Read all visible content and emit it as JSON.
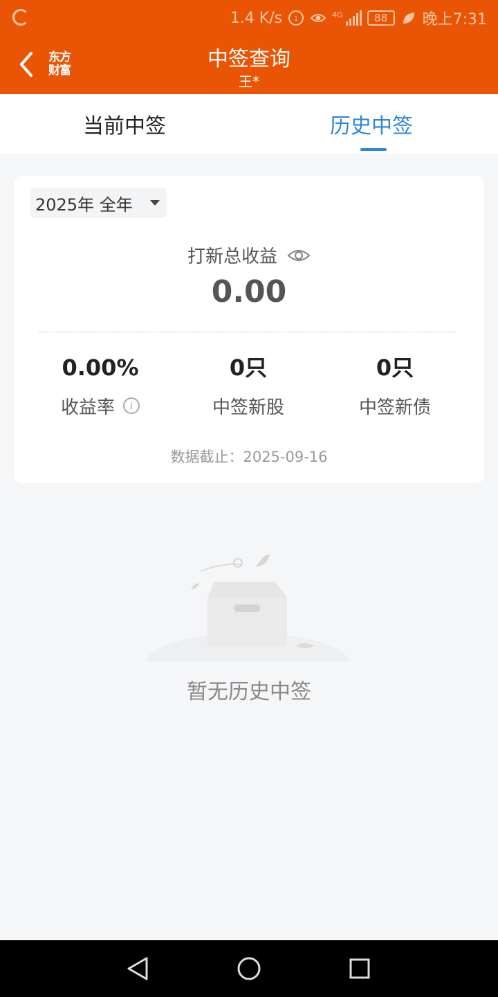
{
  "status_bar": {
    "speed": "1.4 K/s",
    "network": "4G",
    "battery": "88",
    "time": "晚上7:31"
  },
  "header": {
    "title": "中签查询",
    "subtitle": "王*",
    "logo_line1": "东方",
    "logo_line2": "财富"
  },
  "tabs": [
    {
      "label": "当前中签",
      "active": false
    },
    {
      "label": "历史中签",
      "active": true
    }
  ],
  "summary": {
    "year_filter": "2025年 全年",
    "total_label": "打新总收益",
    "total_value": "0.00",
    "stats": [
      {
        "value": "0.00%",
        "label": "收益率"
      },
      {
        "value": "0只",
        "label": "中签新股"
      },
      {
        "value": "0只",
        "label": "中签新债"
      }
    ],
    "cutoff": "数据截止：2025-09-16"
  },
  "empty_state": {
    "text": "暂无历史中签"
  },
  "colors": {
    "brand": "#ea5505",
    "active_tab": "#2e86d6"
  }
}
